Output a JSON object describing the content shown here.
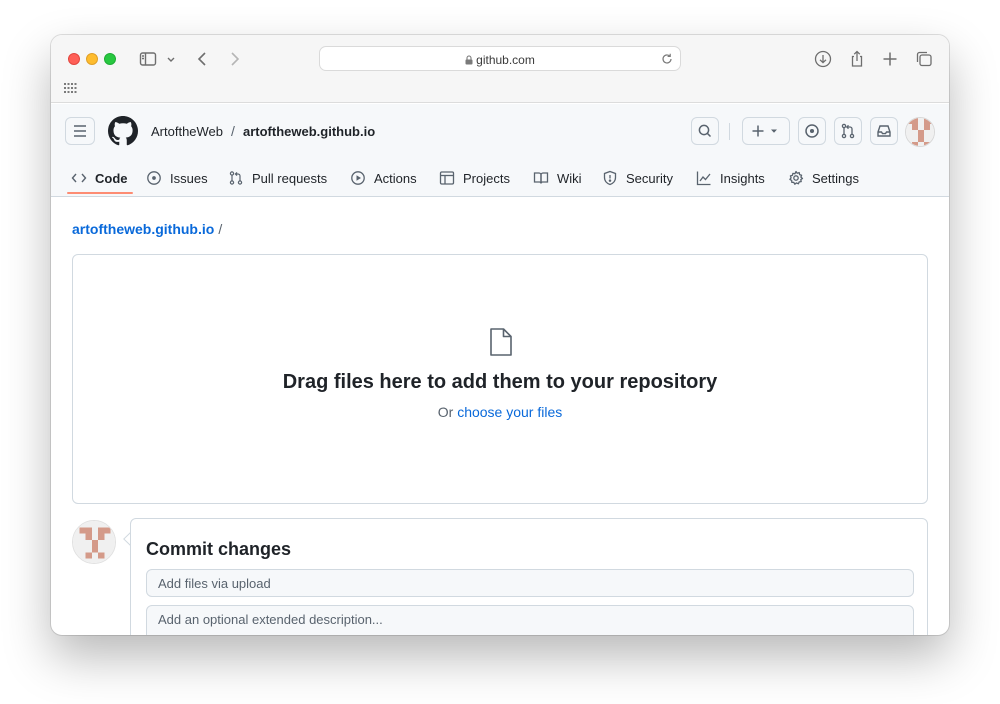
{
  "browser": {
    "url": "github.com",
    "icons": [
      "sidebar-icon",
      "chevron-down-icon",
      "back-icon",
      "forward-icon",
      "lock-icon",
      "reload-icon",
      "download-icon",
      "share-icon",
      "new-tab-icon",
      "tab-overview-icon",
      "grid-icon"
    ]
  },
  "header": {
    "owner": "ArtoftheWeb",
    "separator": "/",
    "repo": "artoftheweb.github.io"
  },
  "tabs": [
    {
      "label": "Code",
      "icon": "code-icon",
      "active": true
    },
    {
      "label": "Issues",
      "icon": "issue-icon"
    },
    {
      "label": "Pull requests",
      "icon": "pull-request-icon"
    },
    {
      "label": "Actions",
      "icon": "play-icon"
    },
    {
      "label": "Projects",
      "icon": "table-icon"
    },
    {
      "label": "Wiki",
      "icon": "book-icon"
    },
    {
      "label": "Security",
      "icon": "shield-icon"
    },
    {
      "label": "Insights",
      "icon": "graph-icon"
    },
    {
      "label": "Settings",
      "icon": "gear-icon"
    }
  ],
  "breadcrumb": {
    "repo": "artoftheweb.github.io",
    "separator": "/"
  },
  "dropzone": {
    "title": "Drag files here to add them to your repository",
    "or_text": "Or",
    "link_text": "choose your files"
  },
  "commit": {
    "title": "Commit changes",
    "summary_placeholder": "Add files via upload",
    "description_placeholder": "Add an optional extended description..."
  },
  "colors": {
    "link": "#0969da",
    "active_tab_underline": "#fd8c73",
    "avatar": "#d49a89"
  }
}
